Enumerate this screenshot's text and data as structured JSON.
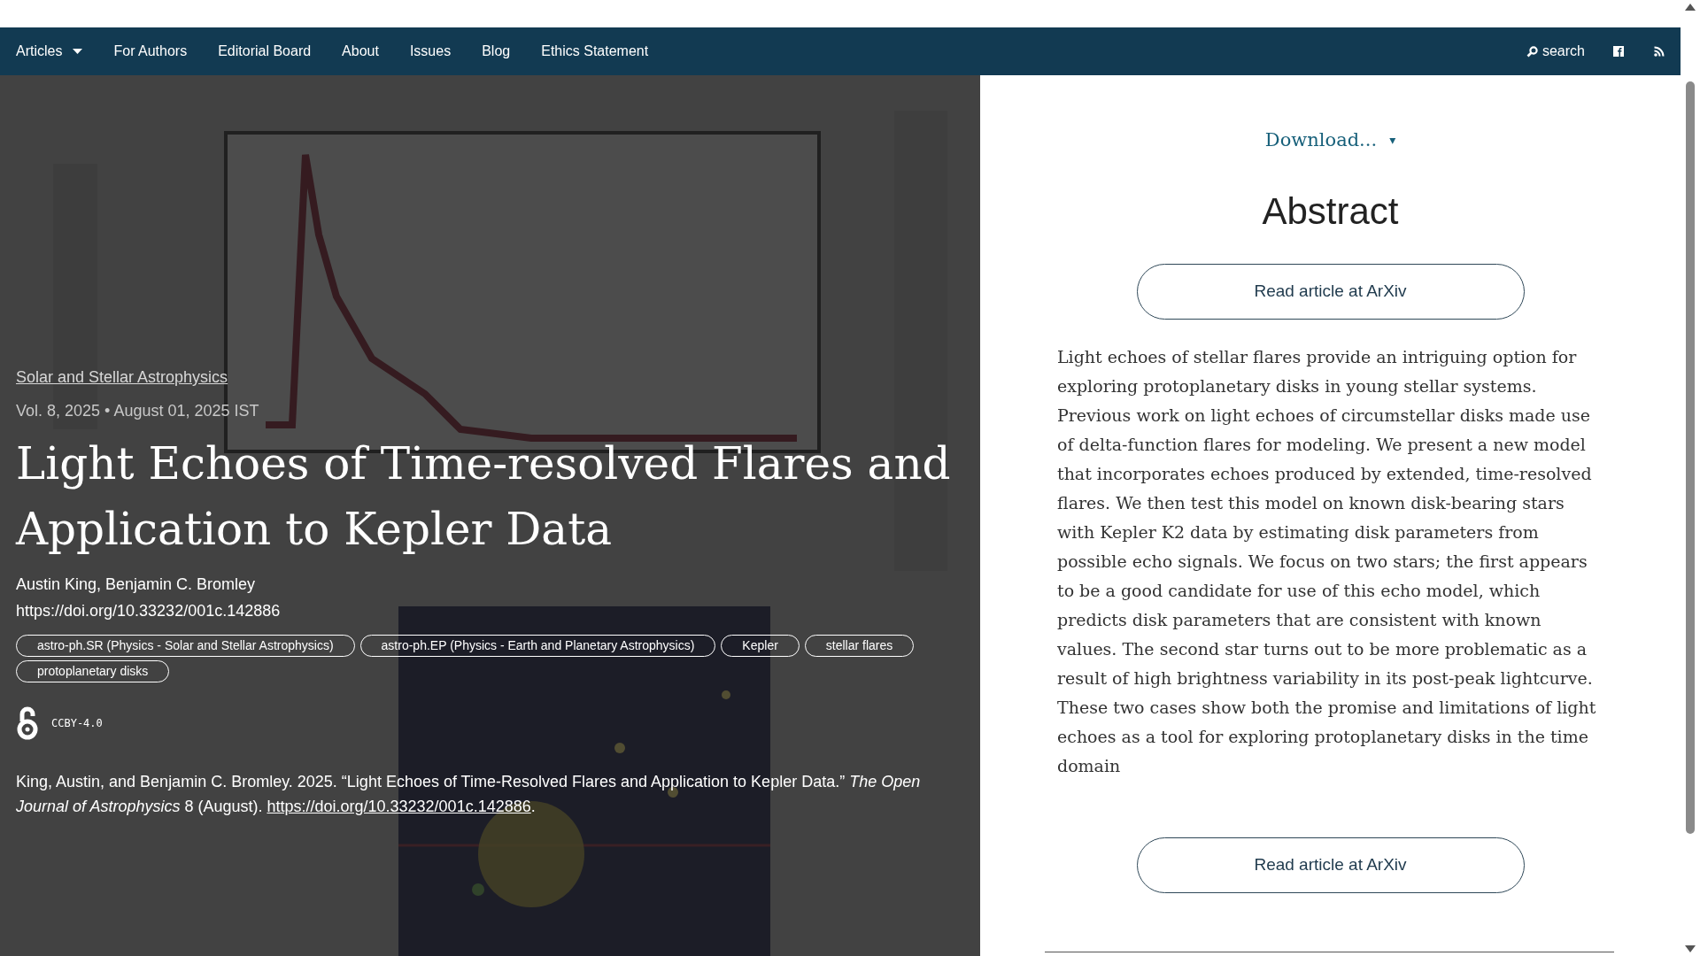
{
  "nav": {
    "items": [
      {
        "label": "Articles",
        "kind": "dropdown"
      },
      {
        "label": "For Authors",
        "kind": "link"
      },
      {
        "label": "Editorial Board",
        "kind": "link"
      },
      {
        "label": "About",
        "kind": "link"
      },
      {
        "label": "Issues",
        "kind": "link"
      },
      {
        "label": "Blog",
        "kind": "link"
      },
      {
        "label": "Ethics Statement",
        "kind": "link"
      }
    ],
    "search": "search"
  },
  "hero": {
    "category": "Solar and Stellar Astrophysics",
    "meta": "Vol. 8, 2025 • August 01, 2025 IST",
    "title": "Light Echoes of Time-resolved Flares and Application to Kepler Data",
    "authors": "Austin King, Benjamin C. Bromley",
    "doi": "https://doi.org/10.33232/001c.142886",
    "tags": [
      "astro-ph.SR (Physics - Solar and Stellar Astrophysics)",
      "astro-ph.EP (Physics - Earth and Planetary Astrophysics)",
      "Kepler",
      "stellar flares",
      "protoplanetary disks"
    ],
    "license": "CCBY-4.0",
    "citation": "King, Austin, and Benjamin C. Bromley. 2025. “Light Echoes of Time-Resolved Flares and Application to Kepler Data.” *The Open Journal of Astrophysics* 8 (August). ",
    "citation_link": "https://doi.org/10.33232/001c.142886",
    "citation_end": "."
  },
  "side": {
    "download": "Download...",
    "download_caret": "▾",
    "heading": "Abstract",
    "buttons": [
      "Read article at ArXiv",
      "Read article at ArXiv"
    ],
    "abstract": "Light echoes of stellar flares provide an intriguing option for exploring protoplanetary disks in young stellar systems. Previous work on light echoes of circumstellar disks made use of delta-function flares for modeling. We present a new model that incorporates echoes produced by extended, time-resolved flares. We then test this model on known disk-bearing stars with Kepler K2 data by estimating disk parameters from possible echo signals. We focus on two stars; the first appears to be a good candidate for use of this echo model, which predicts disk parameters that are consistent with known values. The second star turns out to be more problematic as a result of high brightness variability in its post-peak lightcurve. These two cases show both the promise and limitations of light echoes as a tool for exploring protoplanetary disks in the time domain"
  }
}
